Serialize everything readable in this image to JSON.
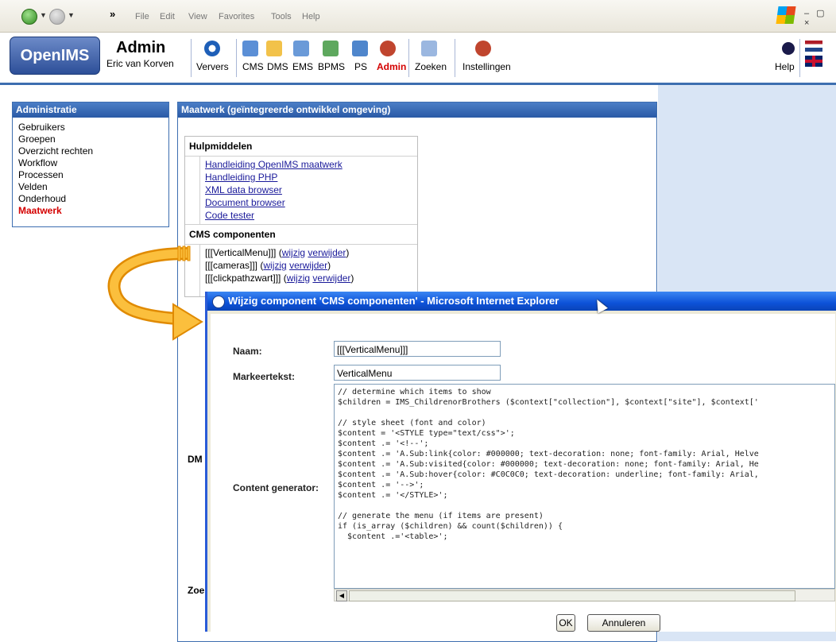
{
  "browser": {
    "menu": [
      "File",
      "Edit",
      "View",
      "Favorites",
      "Tools",
      "Help"
    ],
    "overflow": "»"
  },
  "app": {
    "logo": "OpenIMS",
    "title": "Admin",
    "user": "Eric van Korven",
    "toolbar": [
      {
        "label": "Ververs",
        "icon": "refresh-icon"
      },
      {
        "label": "CMS",
        "icon": "cms-icon"
      },
      {
        "label": "DMS",
        "icon": "folder-icon"
      },
      {
        "label": "EMS",
        "icon": "ems-icon"
      },
      {
        "label": "BPMS",
        "icon": "bpms-icon"
      },
      {
        "label": "PS",
        "icon": "ps-icon"
      },
      {
        "label": "Admin",
        "icon": "admin-people-icon"
      },
      {
        "label": "Zoeken",
        "icon": "search-icon"
      },
      {
        "label": "Instellingen",
        "icon": "person-settings-icon"
      },
      {
        "label": "Help",
        "icon": "help-icon"
      }
    ]
  },
  "sidebar": {
    "title": "Administratie",
    "items": [
      "Gebruikers",
      "Groepen",
      "Overzicht rechten",
      "Workflow",
      "Processen",
      "Velden",
      "Onderhoud",
      "Maatwerk"
    ],
    "active": "Maatwerk"
  },
  "main": {
    "title": "Maatwerk (geïntegreerde ontwikkel omgeving)",
    "hulp": {
      "title": "Hulpmiddelen",
      "links": [
        "Handleiding OpenIMS maatwerk",
        "Handleiding PHP",
        "XML data browser",
        "Document browser",
        "Code tester"
      ]
    },
    "cms": {
      "title": "CMS componenten",
      "items": [
        {
          "name": "[[[VerticalMenu]]]",
          "edit": "wijzig",
          "del": "verwijder"
        },
        {
          "name": "[[[cameras]]]",
          "edit": "wijzig",
          "del": "verwijder"
        },
        {
          "name": "[[[clickpathzwart]]]",
          "edit": "wijzig",
          "del": "verwijder"
        }
      ]
    },
    "dm_truncated": "DM",
    "zoe_truncated": "Zoe"
  },
  "dialog": {
    "title": "Wijzig component 'CMS componenten' - Microsoft Internet Explorer",
    "naam_label": "Naam:",
    "naam_value": "[[[VerticalMenu]]]",
    "marker_label": "Markeertekst:",
    "marker_value": "VerticalMenu",
    "generator_label": "Content generator:",
    "code": "// determine which items to show\n$children = IMS_ChildrenorBrothers ($context[\"collection\"], $context[\"site\"], $context['\n\n// style sheet (font and color)\n$content = '<STYLE type=\"text/css\">';\n$content .= '<!--';\n$content .= 'A.Sub:link{color: #000000; text-decoration: none; font-family: Arial, Helve\n$content .= 'A.Sub:visited{color: #000000; text-decoration: none; font-family: Arial, He\n$content .= 'A.Sub:hover{color: #C0C0C0; text-decoration: underline; font-family: Arial,\n$content .= '-->';\n$content .= '</STYLE>';\n\n// generate the menu (if items are present)\nif (is_array ($children) && count($children)) {\n  $content .='<table>';",
    "ok": "OK",
    "cancel": "Annuleren"
  },
  "colors": {
    "accent": "#3d6eb0",
    "active": "#d40000",
    "arrow": "#f7a823"
  }
}
